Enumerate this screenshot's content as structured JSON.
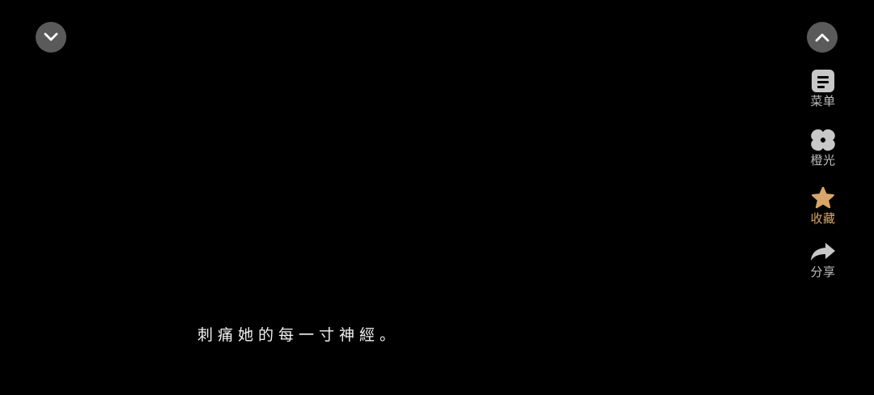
{
  "controls": {
    "collapse_icon": "chevron-down-icon",
    "expand_icon": "chevron-up-icon"
  },
  "actions": [
    {
      "id": "menu",
      "label": "菜单",
      "icon": "menu-document-icon"
    },
    {
      "id": "light",
      "label": "橙光",
      "icon": "clover-leaf-icon"
    },
    {
      "id": "favorite",
      "label": "收藏",
      "icon": "star-icon",
      "active_color": "#d9a56a"
    },
    {
      "id": "share",
      "label": "分享",
      "icon": "share-arrow-icon"
    }
  ],
  "subtitle": "刺痛她的每一寸神經。",
  "colors": {
    "background": "#000000",
    "button_bg": "#5a5a5a",
    "icon_gray": "#c8c8c8",
    "accent": "#d9a56a"
  }
}
